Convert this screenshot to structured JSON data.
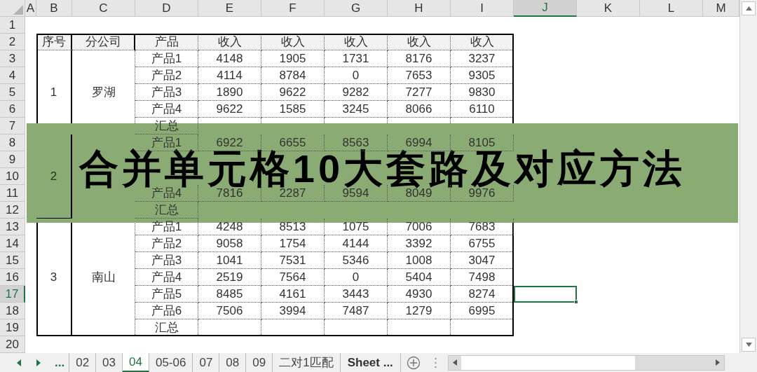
{
  "columns": [
    {
      "label": "A",
      "selected": false
    },
    {
      "label": "B",
      "selected": false
    },
    {
      "label": "C",
      "selected": false
    },
    {
      "label": "D",
      "selected": false
    },
    {
      "label": "E",
      "selected": false
    },
    {
      "label": "F",
      "selected": false
    },
    {
      "label": "G",
      "selected": false
    },
    {
      "label": "H",
      "selected": false
    },
    {
      "label": "I",
      "selected": false
    },
    {
      "label": "J",
      "selected": true
    },
    {
      "label": "K",
      "selected": false
    },
    {
      "label": "L",
      "selected": false
    },
    {
      "label": "M",
      "selected": false
    }
  ],
  "row_numbers": [
    {
      "label": "1",
      "selected": false
    },
    {
      "label": "2",
      "selected": false
    },
    {
      "label": "3",
      "selected": false
    },
    {
      "label": "4",
      "selected": false
    },
    {
      "label": "5",
      "selected": false
    },
    {
      "label": "6",
      "selected": false
    },
    {
      "label": "7",
      "selected": false
    },
    {
      "label": "8",
      "selected": false
    },
    {
      "label": "9",
      "selected": false
    },
    {
      "label": "10",
      "selected": false
    },
    {
      "label": "11",
      "selected": false
    },
    {
      "label": "12",
      "selected": false
    },
    {
      "label": "13",
      "selected": false
    },
    {
      "label": "14",
      "selected": false
    },
    {
      "label": "15",
      "selected": false
    },
    {
      "label": "16",
      "selected": false
    },
    {
      "label": "17",
      "selected": true
    },
    {
      "label": "18",
      "selected": false
    },
    {
      "label": "19",
      "selected": false
    },
    {
      "label": "20",
      "selected": false
    }
  ],
  "table": {
    "header": [
      "序号",
      "分公司",
      "产品",
      "收入",
      "收入",
      "收入",
      "收入",
      "收入"
    ],
    "groups": [
      {
        "index": "1",
        "branch": "罗湖",
        "rows": [
          {
            "product": "产品1",
            "values": [
              "4148",
              "1905",
              "1731",
              "8176",
              "3237"
            ]
          },
          {
            "product": "产品2",
            "values": [
              "4114",
              "8784",
              "0",
              "7653",
              "9305"
            ]
          },
          {
            "product": "产品3",
            "values": [
              "1890",
              "9622",
              "9282",
              "7277",
              "9830"
            ]
          },
          {
            "product": "产品4",
            "values": [
              "9622",
              "1585",
              "3245",
              "8066",
              "6110"
            ]
          },
          {
            "product": "汇总"
          }
        ]
      },
      {
        "index": "2",
        "rows": [
          {
            "product": "产品1",
            "values": [
              "6922",
              "6655",
              "8563",
              "6994",
              "8105"
            ]
          },
          {},
          {},
          {
            "product": "产品4",
            "values": [
              "7816",
              "2287",
              "9594",
              "8049",
              "9976"
            ]
          },
          {
            "product": "汇总"
          }
        ]
      },
      {
        "index": "3",
        "branch": "南山",
        "rows": [
          {
            "product": "产品1",
            "values": [
              "4248",
              "8513",
              "1075",
              "7006",
              "7683"
            ]
          },
          {
            "product": "产品2",
            "values": [
              "9058",
              "1754",
              "4144",
              "3392",
              "6755"
            ]
          },
          {
            "product": "产品3",
            "values": [
              "1041",
              "7531",
              "5346",
              "1008",
              "3047"
            ]
          },
          {
            "product": "产品4",
            "values": [
              "2519",
              "7564",
              "0",
              "5404",
              "7498"
            ]
          },
          {
            "product": "产品5",
            "values": [
              "8485",
              "4161",
              "3443",
              "4930",
              "8274"
            ]
          },
          {
            "product": "产品6",
            "values": [
              "7506",
              "3994",
              "7487",
              "1279",
              "6995"
            ]
          },
          {
            "product": "汇总"
          }
        ]
      }
    ]
  },
  "banner": {
    "title": "合并单元格10大套路及对应方法"
  },
  "sheet_tabs": [
    {
      "label": "...",
      "kind": "more",
      "selected": false
    },
    {
      "label": "02",
      "kind": "sheet",
      "selected": false
    },
    {
      "label": "03",
      "kind": "sheet",
      "selected": false
    },
    {
      "label": "04",
      "kind": "sheet",
      "selected": true
    },
    {
      "label": "05-06",
      "kind": "sheet",
      "selected": false
    },
    {
      "label": "07",
      "kind": "sheet",
      "selected": false
    },
    {
      "label": "08",
      "kind": "sheet",
      "selected": false
    },
    {
      "label": "09",
      "kind": "sheet",
      "selected": false
    },
    {
      "label": "二对1匹配",
      "kind": "sheet",
      "selected": false
    },
    {
      "label": "Sheet ...",
      "kind": "more-bold",
      "selected": false
    }
  ]
}
